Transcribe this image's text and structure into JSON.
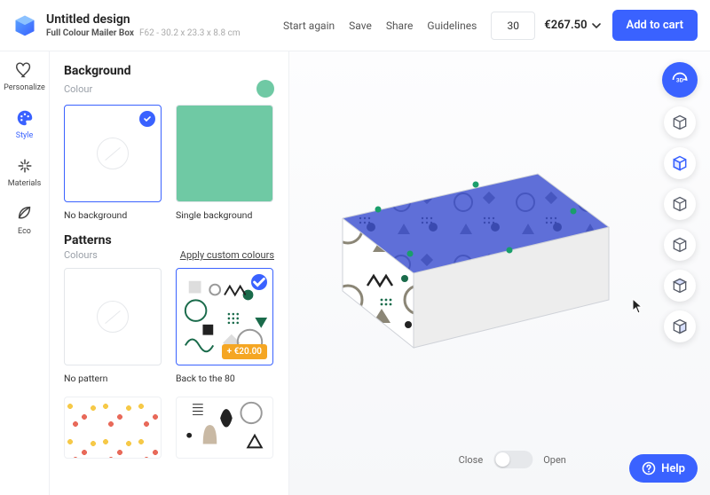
{
  "header": {
    "title": "Untitled design",
    "product": "Full Colour Mailer Box",
    "sku": "F62 - 30.2 x 23.3 x 8.8 cm",
    "links": {
      "start": "Start again",
      "save": "Save",
      "share": "Share",
      "guidelines": "Guidelines"
    },
    "qty": "30",
    "price": "€267.50",
    "cart": "Add to cart"
  },
  "rail": {
    "personalize": "Personalize",
    "style": "Style",
    "materials": "Materials",
    "eco": "Eco"
  },
  "panel": {
    "background": {
      "title": "Background",
      "sub": "Colour"
    },
    "bg_options": {
      "none": "No background",
      "single": "Single background"
    },
    "patterns": {
      "title": "Patterns",
      "sub": "Colours",
      "apply": "Apply custom colours"
    },
    "pat_options": {
      "none": "No pattern",
      "eighties": "Back to the 80",
      "price": "+ €20.00"
    }
  },
  "canvas": {
    "close": "Close",
    "open": "Open"
  },
  "help": "Help",
  "tools": {
    "threeD": "3D"
  }
}
